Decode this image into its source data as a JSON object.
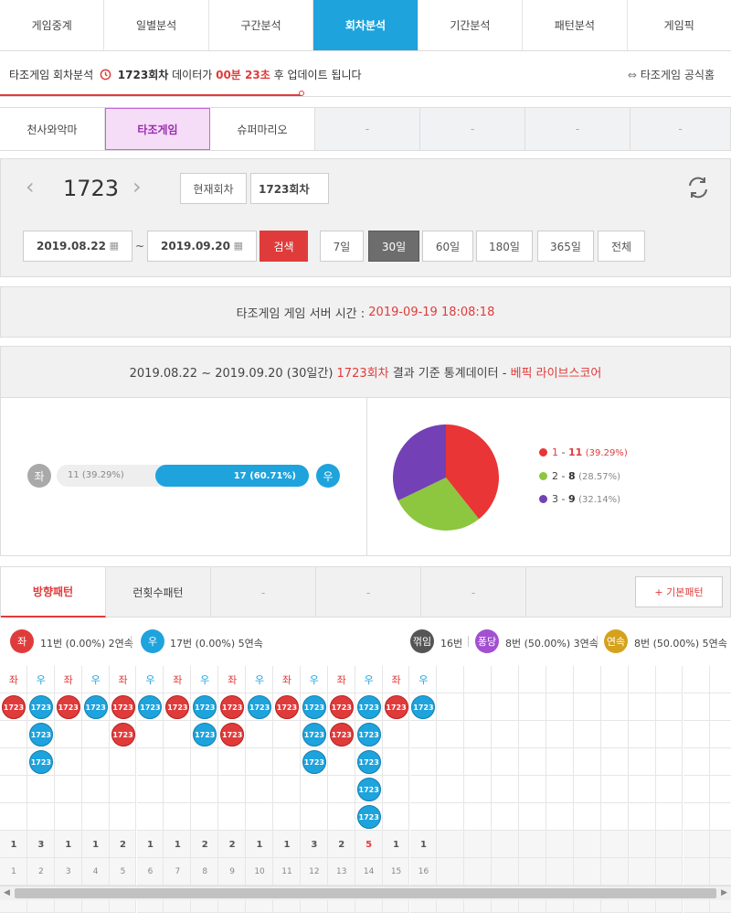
{
  "top_tabs": [
    "게임중계",
    "일별분석",
    "구간분석",
    "회차분석",
    "기간분석",
    "패턴분석",
    "게임픽"
  ],
  "top_tabs_active": 3,
  "info": {
    "game": "타조게임 회차분석",
    "round": "1723회차",
    "mid": "데이터가",
    "time": "00분 23초",
    "tail": "후 업데이트 됩니다",
    "home_link": "타조게임 공식홈"
  },
  "game_tabs": [
    "천사와악마",
    "타조게임",
    "슈퍼마리오",
    "-",
    "-",
    "-",
    "-"
  ],
  "round_panel": {
    "round_number": "1723",
    "current_label": "현재회차",
    "round_value": "1723회차",
    "start_date": "2019.08.22",
    "tilde": "~",
    "end_date": "2019.09.20",
    "search_label": "검색",
    "periods": [
      "7일",
      "30일",
      "60일",
      "180일",
      "365일",
      "전체"
    ]
  },
  "server": {
    "label": "타조게임 게임 서버 시간 :",
    "time": "2019-09-19 18:08:18"
  },
  "stats": {
    "range": "2019.08.22 ~ 2019.09.20 (30일간)",
    "round": "1723회차",
    "mid": "결과 기준 통계데이터 -",
    "source": "베픽 라이브스코어",
    "left_label": "좌",
    "right_label": "우",
    "left_text": "11 (39.29%)",
    "right_text": "17 (60.71%)",
    "right_fraction": 0.6071
  },
  "pie": {
    "slices": [
      {
        "label": "1",
        "count": "11",
        "pct": "(39.29%)",
        "value": 11,
        "color": "#e93535"
      },
      {
        "label": "2",
        "count": "8",
        "pct": "(28.57%)",
        "value": 8,
        "color": "#8dc63f"
      },
      {
        "label": "3",
        "count": "9",
        "pct": "(32.14%)",
        "value": 9,
        "color": "#7340b5"
      }
    ]
  },
  "pattern_tabs": [
    "방향패턴",
    "런횟수패턴",
    "-",
    "-",
    "-"
  ],
  "basic_pattern_btn": "+ 기본패턴",
  "summary": {
    "left_icon": "좌",
    "left_text": "11번 (0.00%) 2연속",
    "right_icon": "우",
    "right_text": "17번 (0.00%) 5연속",
    "flip_icon": "꺾임",
    "flip_text": "16번",
    "pong_icon": "퐁당",
    "pong_text": "8번 (50.00%) 3연속",
    "cont_icon": "연속",
    "cont_text": "8번 (50.00%) 5연속"
  },
  "pattern": {
    "ball_label": "1723",
    "columns": [
      {
        "dir": "좌",
        "side": "L",
        "count": 1
      },
      {
        "dir": "우",
        "side": "R",
        "count": 3
      },
      {
        "dir": "좌",
        "side": "L",
        "count": 1
      },
      {
        "dir": "우",
        "side": "R",
        "count": 1
      },
      {
        "dir": "좌",
        "side": "L",
        "count": 2
      },
      {
        "dir": "우",
        "side": "R",
        "count": 1
      },
      {
        "dir": "좌",
        "side": "L",
        "count": 1
      },
      {
        "dir": "우",
        "side": "R",
        "count": 2
      },
      {
        "dir": "좌",
        "side": "L",
        "count": 2
      },
      {
        "dir": "우",
        "side": "R",
        "count": 1
      },
      {
        "dir": "좌",
        "side": "L",
        "count": 1
      },
      {
        "dir": "우",
        "side": "R",
        "count": 3
      },
      {
        "dir": "좌",
        "side": "L",
        "count": 2
      },
      {
        "dir": "우",
        "side": "R",
        "count": 5
      },
      {
        "dir": "좌",
        "side": "L",
        "count": 1
      },
      {
        "dir": "우",
        "side": "R",
        "count": 1
      }
    ],
    "max_highlight": 5,
    "indices": [
      "1",
      "2",
      "3",
      "4",
      "5",
      "6",
      "7",
      "8",
      "9",
      "10",
      "11",
      "12",
      "13",
      "14",
      "15",
      "16"
    ]
  }
}
